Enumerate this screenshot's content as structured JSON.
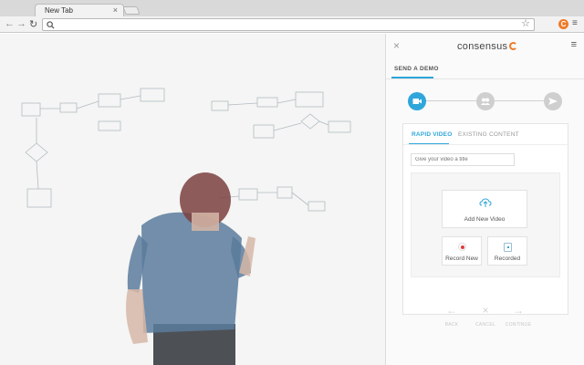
{
  "browser": {
    "tab_title": "New Tab",
    "tab_close": "×",
    "back_icon": "←",
    "forward_icon": "→",
    "reload_icon": "↻",
    "search_icon": "🔍",
    "star_icon": "☆",
    "extension_icon_letter": "C",
    "menu_icon": "≡"
  },
  "panel": {
    "close_icon": "×",
    "brand": "consensus",
    "menu_icon": "≡",
    "title": "SEND A DEMO",
    "accent_color": "#2ea6da",
    "brand_color": "#f07a28",
    "steps": [
      {
        "icon": "video-camera-icon",
        "glyph": "■",
        "active": true
      },
      {
        "icon": "people-icon",
        "glyph": "●",
        "active": false
      },
      {
        "icon": "send-icon",
        "glyph": "➤",
        "active": false
      }
    ],
    "card": {
      "tab_active": "RAPID VIDEO",
      "tab_inactive": "EXISTING CONTENT",
      "title_placeholder": "Give your video a title",
      "add_video_icon": "⇧",
      "add_video_label": "Add New Video",
      "record_label": "Record New",
      "recorded_label": "Recorded"
    },
    "footer": {
      "back_icon": "←",
      "back_label": "BACK",
      "cancel_icon": "×",
      "cancel_label": "CANCEL",
      "continue_icon": "→",
      "continue_label": "CONTINUE"
    }
  }
}
